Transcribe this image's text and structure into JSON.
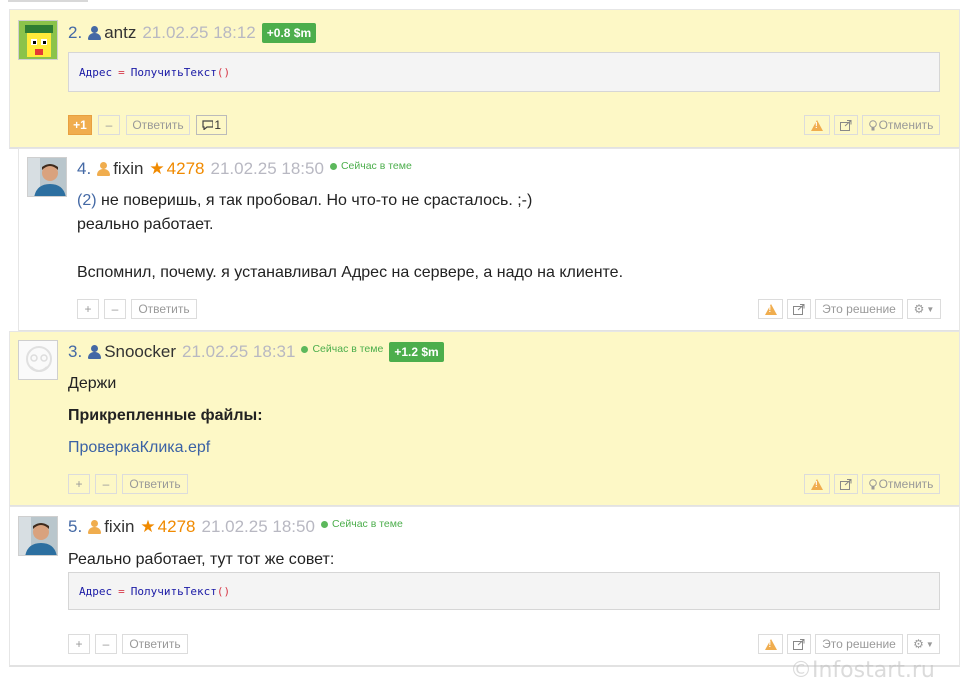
{
  "posts": [
    {
      "number": "2.",
      "user": "antz",
      "user_role_color": "#4469a5",
      "date": "21.02.25 18:12",
      "money": "+0.8 $m",
      "code": {
        "id": "Адрес",
        "op": "=",
        "fn": "ПолучитьТекст",
        "par": "()"
      },
      "buttons": {
        "plus": "+1",
        "minus": "–",
        "reply": "Ответить",
        "comments": "1",
        "cancel": "Отменить"
      }
    },
    {
      "number": "4.",
      "user": "fixin",
      "user_role_color": "#f0ad4e",
      "rating": "4278",
      "date": "21.02.25 18:50",
      "online": "Сейчас в теме",
      "ref": "(2)",
      "lines": [
        "не поверишь, я так пробовал. Но что-то не срасталось. ;-)",
        "реально работает.",
        "Вспомнил, почему. я устанавливал Адрес на сервере, а надо на клиенте."
      ],
      "buttons": {
        "plus": "+",
        "minus": "–",
        "reply": "Ответить",
        "solution": "Это решение"
      }
    },
    {
      "number": "3.",
      "user": "Snoocker",
      "user_role_color": "#4469a5",
      "date": "21.02.25 18:31",
      "online": "Сейчас в теме",
      "money": "+1.2 $m",
      "text": "Держи",
      "attachments_label": "Прикрепленные файлы:",
      "file": "ПроверкаКлика.epf",
      "buttons": {
        "plus": "+",
        "minus": "–",
        "reply": "Ответить",
        "cancel": "Отменить"
      }
    },
    {
      "number": "5.",
      "user": "fixin",
      "user_role_color": "#f0ad4e",
      "rating": "4278",
      "date": "21.02.25 18:50",
      "online": "Сейчас в теме",
      "text": "Реально работает, тут тот же совет:",
      "code": {
        "id": "Адрес",
        "op": "=",
        "fn": "ПолучитьТекст",
        "par": "()"
      },
      "buttons": {
        "plus": "+",
        "minus": "–",
        "reply": "Ответить",
        "solution": "Это решение"
      }
    }
  ],
  "icons": {
    "user": "user-icon",
    "star": "star-icon",
    "warning": "warning-icon",
    "share": "share-icon",
    "bulb": "bulb-icon",
    "gear": "gear-icon",
    "comment": "comment-icon"
  },
  "colors": {
    "highlight_bg": "#fdf8c6",
    "link": "#4469a5",
    "rating": "#f08a00",
    "online": "#5cb85c",
    "money_badge": "#4cae4c",
    "plus_active": "#f0ad4e"
  },
  "watermark": "©Infostart.ru"
}
